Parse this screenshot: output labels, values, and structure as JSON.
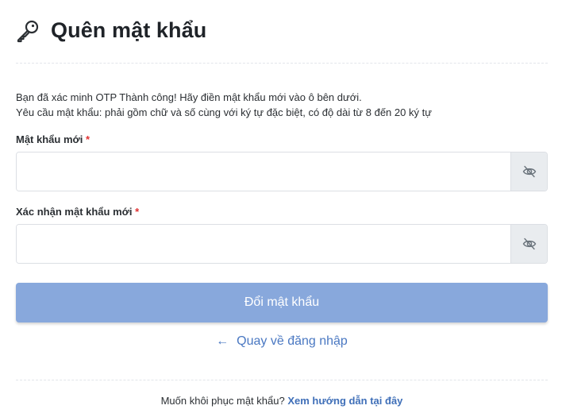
{
  "header": {
    "icon": "key-icon",
    "title": "Quên mật khẩu"
  },
  "intro": {
    "line1": "Bạn đã xác minh OTP Thành công! Hãy điền mật khẩu mới vào ô bên dưới.",
    "line2": "Yêu cầu mật khẩu: phải gồm chữ và số cùng với ký tự đặc biệt, có độ dài từ 8 đến 20 ký tự"
  },
  "fields": {
    "new_password": {
      "label": "Mật khẩu mới",
      "required_mark": "*",
      "value": "",
      "toggle_icon": "eye-slash-icon"
    },
    "confirm_password": {
      "label": "Xác nhận mật khẩu mới",
      "required_mark": "*",
      "value": "",
      "toggle_icon": "eye-slash-icon"
    }
  },
  "actions": {
    "submit_label": "Đổi mật khẩu",
    "back_arrow": "←",
    "back_label": "Quay về đăng nhập"
  },
  "footer": {
    "text": "Muốn khôi phục mật khẩu?",
    "link_label": "Xem hướng dẫn tại đây"
  },
  "colors": {
    "button_bg": "#88a8dc",
    "link": "#4a78c2",
    "required": "#e03131"
  }
}
